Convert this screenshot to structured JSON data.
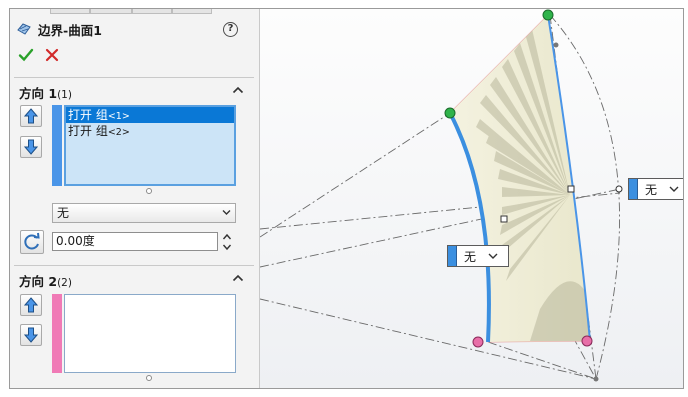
{
  "panel": {
    "title": "边界-曲面1",
    "help_label": "?",
    "direction1": {
      "title": "方向 1",
      "count": "(1)",
      "items": [
        {
          "label": "打开 组",
          "suffix": "<1>",
          "selected": true
        },
        {
          "label": "打开 组",
          "suffix": "<2>",
          "selected": false
        }
      ],
      "list_color": "#4a95e8",
      "tangency_select": "无",
      "angle_value": "0.00度"
    },
    "direction2": {
      "title": "方向 2",
      "count": "(2)",
      "list_color": "#f07ab6"
    }
  },
  "viewport": {
    "callout_left": "无",
    "callout_right": "无"
  },
  "colors": {
    "accent_blue": "#3b8fe0",
    "ok_green": "#2aa12a",
    "cancel_red": "#d22a2a",
    "endpoint_green": "#2fb34a",
    "endpoint_pink": "#e86fa8"
  }
}
